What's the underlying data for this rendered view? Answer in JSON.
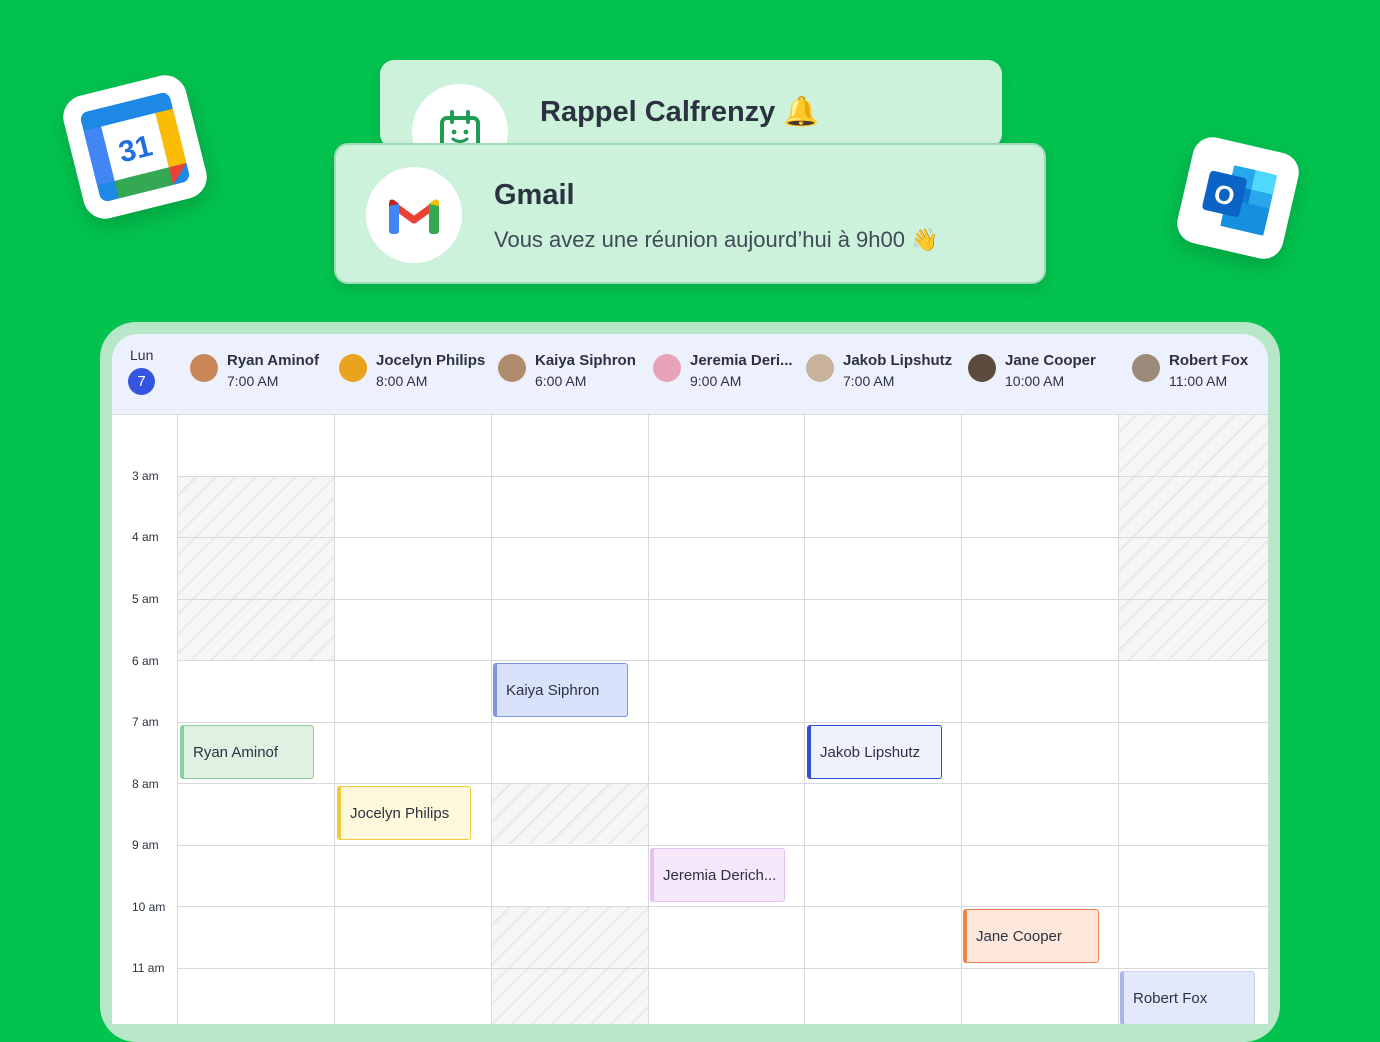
{
  "notifications": {
    "calfrenzy": {
      "title": "Rappel Calfrenzy 🔔"
    },
    "gmail": {
      "title": "Gmail",
      "message": "Vous avez une réunion aujourd’hui à 9h00 👋"
    }
  },
  "app_icons": {
    "google_calendar": {
      "label": "31"
    },
    "outlook": {
      "label": "O"
    }
  },
  "calendar": {
    "day_label": "Lun",
    "day_number": "7",
    "people": [
      {
        "name": "Ryan Aminof",
        "time": "7:00 AM",
        "avatar_color": "#c9875a"
      },
      {
        "name": "Jocelyn Philips",
        "time": "8:00 AM",
        "avatar_color": "#e8a41c"
      },
      {
        "name": "Kaiya Siphron",
        "time": "6:00 AM",
        "avatar_color": "#b08c6c"
      },
      {
        "name": "Jeremia Deri...",
        "time": "9:00 AM",
        "avatar_color": "#e7a3b8"
      },
      {
        "name": "Jakob Lipshutz",
        "time": "7:00 AM",
        "avatar_color": "#c7b39b"
      },
      {
        "name": "Jane Cooper",
        "time": "10:00 AM",
        "avatar_color": "#5b4a3e"
      },
      {
        "name": "Robert Fox",
        "time": "11:00 AM",
        "avatar_color": "#9b8b7a"
      }
    ],
    "hours": [
      "3 am",
      "4 am",
      "5 am",
      "6 am",
      "7 am",
      "8 am",
      "9 am",
      "10 am",
      "11 am"
    ],
    "events": [
      {
        "label": "Ryan Aminof",
        "bg": "#dff1e2",
        "border": "#8bcf9b",
        "accent": "#8bcf9b"
      },
      {
        "label": "Jocelyn Philips",
        "bg": "#fff8dc",
        "border": "#f0cc3d",
        "accent": "#f0cc3d"
      },
      {
        "label": "Kaiya Siphron",
        "bg": "#d9e2fb",
        "border": "#7f95e6",
        "accent": "#7f95e6"
      },
      {
        "label": "Jeremia Derich...",
        "bg": "#f7e7fb",
        "border": "#e3c2ef",
        "accent": "#e3c2ef"
      },
      {
        "label": "Jakob Lipshutz",
        "bg": "#eef2fd",
        "border": "#2f4fd4",
        "accent": "#2f4fd4"
      },
      {
        "label": "Jane Cooper",
        "bg": "#fde6da",
        "border": "#f0834d",
        "accent": "#f0834d"
      },
      {
        "label": "Robert Fox",
        "bg": "#e3e9fb",
        "border": "#c8d1f3",
        "accent": "#a9b6ea"
      }
    ]
  }
}
